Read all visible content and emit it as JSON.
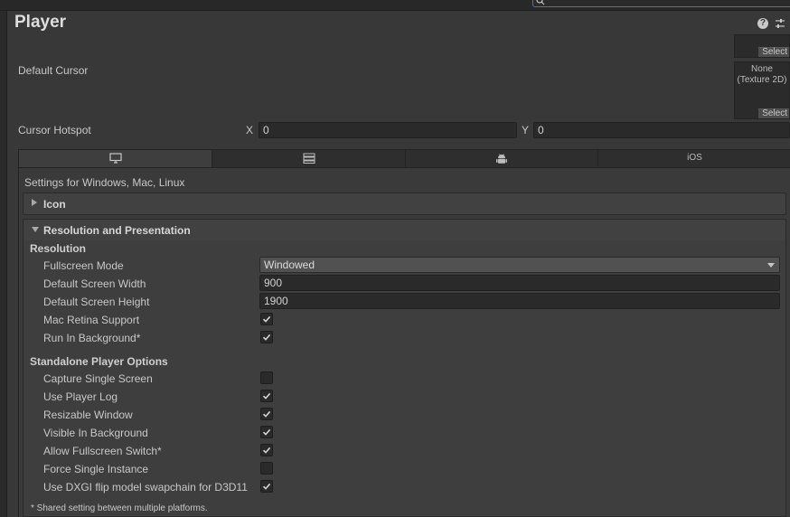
{
  "window": {
    "title": "Player"
  },
  "toolbar": {
    "search_placeholder": "",
    "help_icon": "help-icon",
    "settings_icon": "sliders-icon"
  },
  "cursor": {
    "default_cursor_label": "Default Cursor",
    "icon_slot_select": "Select",
    "cursor_texture_caption": "None\n(Texture 2D)",
    "cursor_select": "Select",
    "hotspot_label": "Cursor Hotspot",
    "x_label": "X",
    "x_value": "0",
    "y_label": "Y",
    "y_value": "0"
  },
  "platform_tabs": [
    {
      "name": "standalone",
      "icon": "monitor-icon",
      "label": "",
      "active": true
    },
    {
      "name": "server",
      "icon": "server-icon",
      "label": "",
      "active": false
    },
    {
      "name": "android",
      "icon": "android-icon",
      "label": "",
      "active": false
    },
    {
      "name": "ios",
      "icon": "",
      "label": "iOS",
      "active": false
    }
  ],
  "settings_header": "Settings for Windows, Mac, Linux",
  "sections": {
    "icon": {
      "title": "Icon",
      "expanded": false
    },
    "resolution_presentation": {
      "title": "Resolution and Presentation",
      "expanded": true
    }
  },
  "resolution": {
    "heading": "Resolution",
    "fullscreen_mode_label": "Fullscreen Mode",
    "fullscreen_mode_value": "Windowed",
    "width_label": "Default Screen Width",
    "width_value": "900",
    "height_label": "Default Screen Height",
    "height_value": "1900",
    "retina_label": "Mac Retina Support",
    "retina_checked": true,
    "run_bg_label": "Run In Background*",
    "run_bg_checked": true
  },
  "standalone": {
    "heading": "Standalone Player Options",
    "options": [
      {
        "label": "Capture Single Screen",
        "checked": false
      },
      {
        "label": "Use Player Log",
        "checked": true
      },
      {
        "label": "Resizable Window",
        "checked": true
      },
      {
        "label": "Visible In Background",
        "checked": true
      },
      {
        "label": "Allow Fullscreen Switch*",
        "checked": true
      },
      {
        "label": "Force Single Instance",
        "checked": false
      },
      {
        "label": "Use DXGI flip model swapchain for D3D11",
        "checked": true
      }
    ]
  },
  "footnote": "* Shared setting between multiple platforms."
}
